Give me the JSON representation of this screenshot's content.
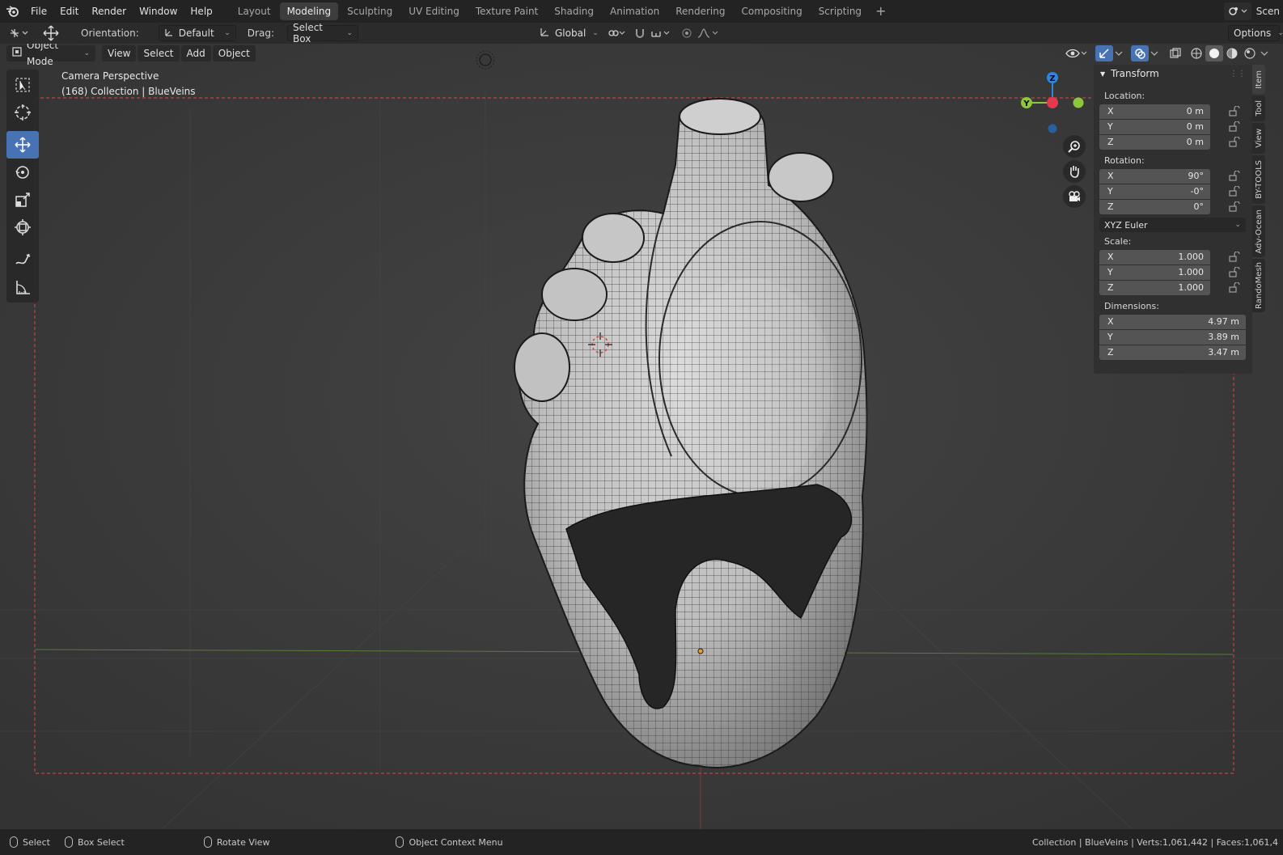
{
  "topbar": {
    "menus": [
      "File",
      "Edit",
      "Render",
      "Window",
      "Help"
    ],
    "workspaces": [
      "Layout",
      "Modeling",
      "Sculpting",
      "UV Editing",
      "Texture Paint",
      "Shading",
      "Animation",
      "Rendering",
      "Compositing",
      "Scripting"
    ],
    "active_workspace": "Modeling",
    "add_tab": "+",
    "scene_label": "Scen"
  },
  "toolheader": {
    "orientation_label": "Orientation:",
    "orientation_value": "Default",
    "drag_label": "Drag:",
    "drag_value": "Select Box",
    "transform_orientation": "Global",
    "options_label": "Options"
  },
  "viewport": {
    "mode": "Object Mode",
    "menus": [
      "View",
      "Select",
      "Add",
      "Object"
    ],
    "camera_label": "Camera Perspective",
    "collection_label": "(168) Collection | BlueVeins",
    "gizmo": {
      "z": "Z",
      "y": "Y"
    }
  },
  "npanel": {
    "title": "Transform",
    "location_label": "Location:",
    "location": [
      {
        "axis": "X",
        "value": "0 m"
      },
      {
        "axis": "Y",
        "value": "0 m"
      },
      {
        "axis": "Z",
        "value": "0 m"
      }
    ],
    "rotation_label": "Rotation:",
    "rotation": [
      {
        "axis": "X",
        "value": "90°"
      },
      {
        "axis": "Y",
        "value": "-0°"
      },
      {
        "axis": "Z",
        "value": "0°"
      }
    ],
    "rotation_mode": "XYZ Euler",
    "scale_label": "Scale:",
    "scale": [
      {
        "axis": "X",
        "value": "1.000"
      },
      {
        "axis": "Y",
        "value": "1.000"
      },
      {
        "axis": "Z",
        "value": "1.000"
      }
    ],
    "dimensions_label": "Dimensions:",
    "dimensions": [
      {
        "axis": "X",
        "value": "4.97 m"
      },
      {
        "axis": "Y",
        "value": "3.89 m"
      },
      {
        "axis": "Z",
        "value": "3.47 m"
      }
    ],
    "tabs": [
      "Item",
      "Tool",
      "View",
      "BY-TOOLS",
      "Adv-Ocean",
      "RandoMesh"
    ]
  },
  "statusbar": {
    "select": "Select",
    "box_select": "Box Select",
    "rotate_view": "Rotate View",
    "context_menu": "Object Context Menu",
    "stats": "Collection | BlueVeins | Verts:1,061,442 | Faces:1,061,4"
  },
  "colors": {
    "accent": "#4772b3",
    "axis_x": "#e8384f",
    "axis_y": "#8cc73c",
    "axis_z": "#2f85e0",
    "camera_frame": "#c0443a"
  }
}
